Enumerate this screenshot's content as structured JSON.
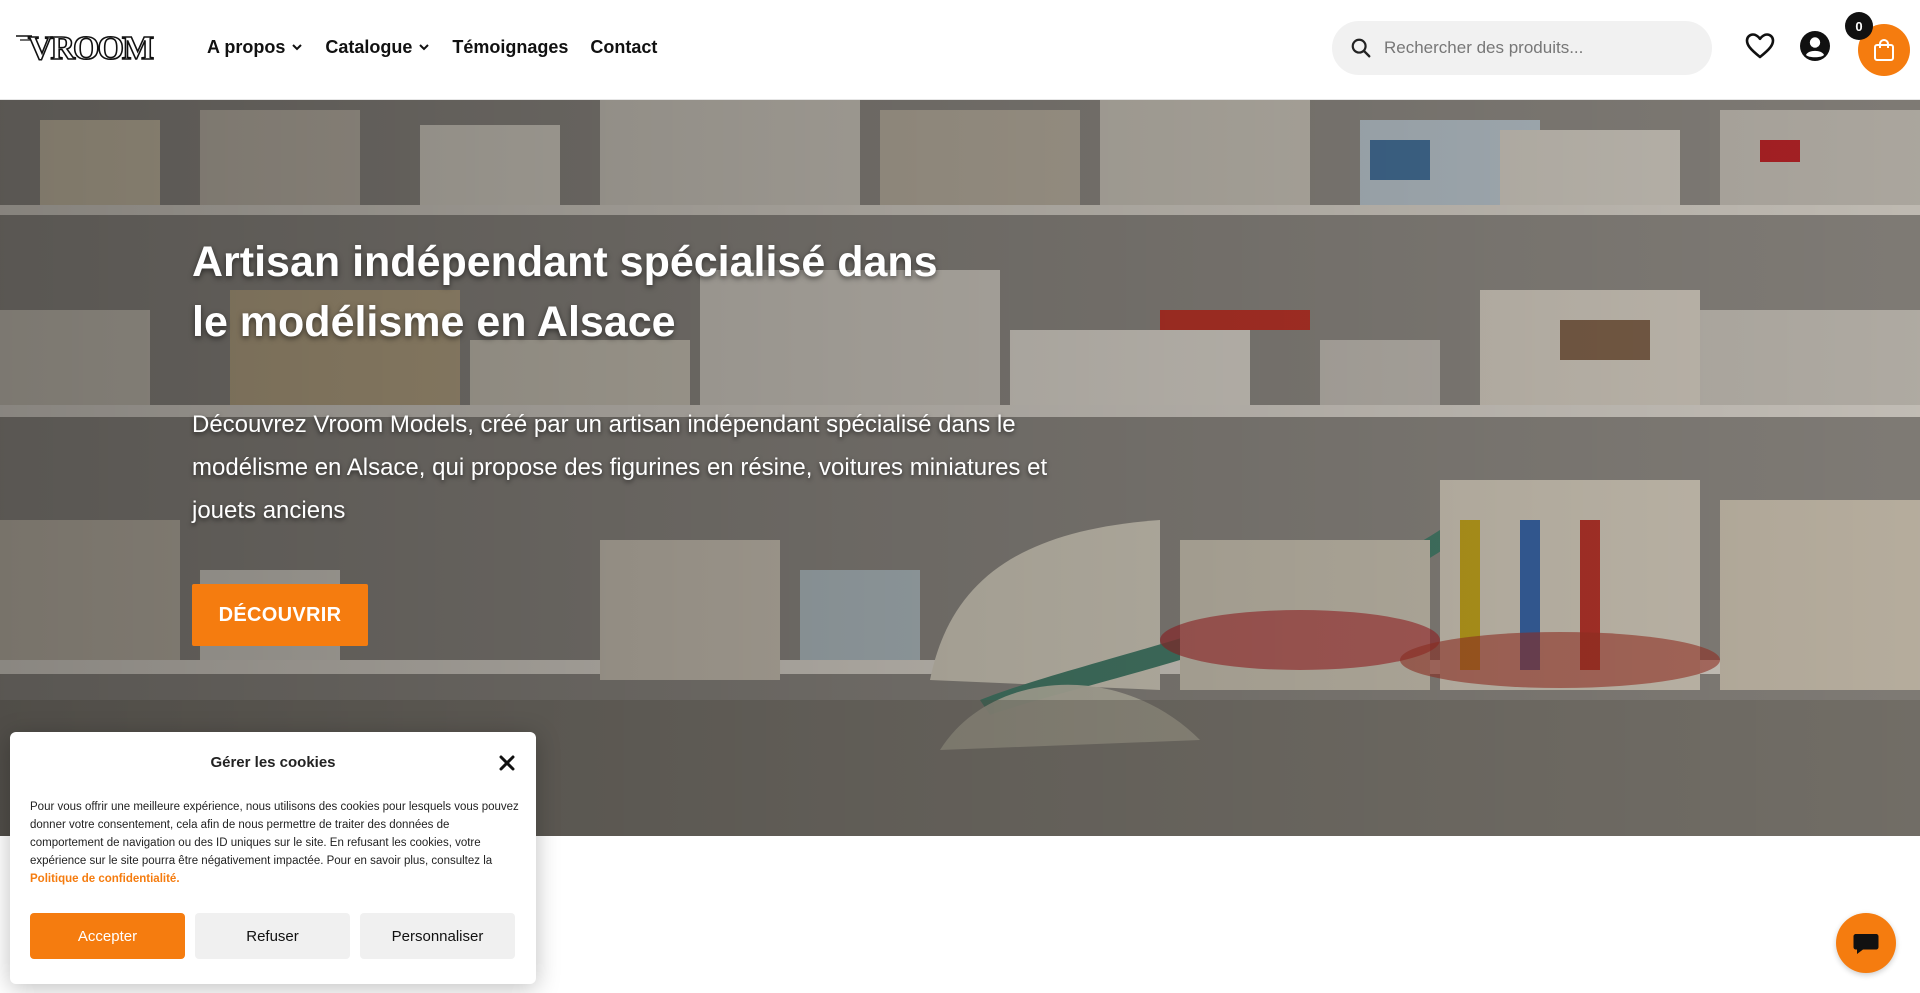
{
  "header": {
    "logo_text": "VROOM",
    "nav": [
      {
        "label": "A propos",
        "has_dropdown": true
      },
      {
        "label": "Catalogue",
        "has_dropdown": true
      },
      {
        "label": "Témoignages",
        "has_dropdown": false
      },
      {
        "label": "Contact",
        "has_dropdown": false
      }
    ],
    "search_placeholder": "Rechercher des produits...",
    "wishlist_icon": "heart-icon",
    "account_icon": "user-circle-icon",
    "cart_icon": "shopping-bag-icon",
    "cart_count": "0"
  },
  "hero": {
    "title": "Artisan indépendant spécialisé dans le modélisme en Alsace",
    "text": "Découvrez Vroom Models, créé par un artisan indépendant spécialisé dans le modélisme en Alsace, qui propose des figurines en résine, voitures miniatures et jouets anciens",
    "button_label": "DÉCOUVRIR"
  },
  "cookie_banner": {
    "title": "Gérer les cookies",
    "text": "Pour vous offrir une meilleure expérience, nous utilisons des cookies pour lesquels vous pouvez donner votre consentement, cela afin de nous permettre de traiter des données de comportement de navigation ou des ID uniques sur le site. En refusant les cookies, votre expérience sur le site pourra être négativement impactée. Pour en savoir plus, consultez la ",
    "link_label": "Politique de confidentialité.",
    "accept_label": "Accepter",
    "refuse_label": "Refuser",
    "customize_label": "Personnaliser"
  },
  "chat_icon": "chat-bubble-icon",
  "colors": {
    "accent": "#f57c0f",
    "dark": "#111111"
  }
}
